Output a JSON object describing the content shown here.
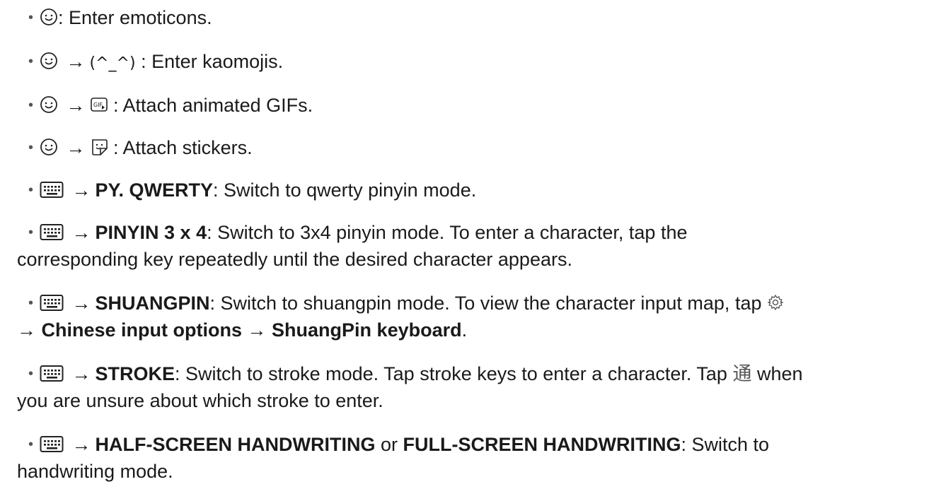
{
  "items": [
    {
      "text": ": Enter emoticons."
    },
    {
      "arrow": "→",
      "kaomoji": "(^_^)",
      "text": ": Enter kaomojis."
    },
    {
      "arrow": "→",
      "gif_label": "GIF",
      "text": ": Attach animated GIFs."
    },
    {
      "arrow": "→",
      "text": ": Attach stickers."
    },
    {
      "arrow": "→",
      "mode": "PY. QWERTY",
      "text": ": Switch to qwerty pinyin mode."
    },
    {
      "arrow": "→",
      "mode": "PINYIN 3 x 4",
      "text": ": Switch to 3x4 pinyin mode. To enter a character, tap the",
      "text2": "corresponding key repeatedly until the desired character appears."
    },
    {
      "arrow": "→",
      "mode": "SHUANGPIN",
      "text": ": Switch to shuangpin mode. To view the character input map, tap",
      "path1": "Chinese input options",
      "path2": "ShuangPin keyboard",
      "end": "."
    },
    {
      "arrow": "→",
      "mode": "STROKE",
      "text": ": Switch to stroke mode. Tap stroke keys to enter a character. Tap",
      "char": "通",
      "text_after": "when",
      "text2": "you are unsure about which stroke to enter."
    },
    {
      "arrow": "→",
      "mode": "HALF-SCREEN HANDWRITING",
      "or": "or",
      "mode2": "FULL-SCREEN HANDWRITING",
      "text": ": Switch to",
      "text2": "handwriting mode."
    }
  ],
  "bullet": "•",
  "icons": {
    "emoticon": "smiley-face-icon",
    "kaomoji": "kaomoji-icon",
    "gif": "gif-icon",
    "sticker": "sticker-icon",
    "keyboard": "keyboard-icon",
    "settings": "gear-icon"
  }
}
